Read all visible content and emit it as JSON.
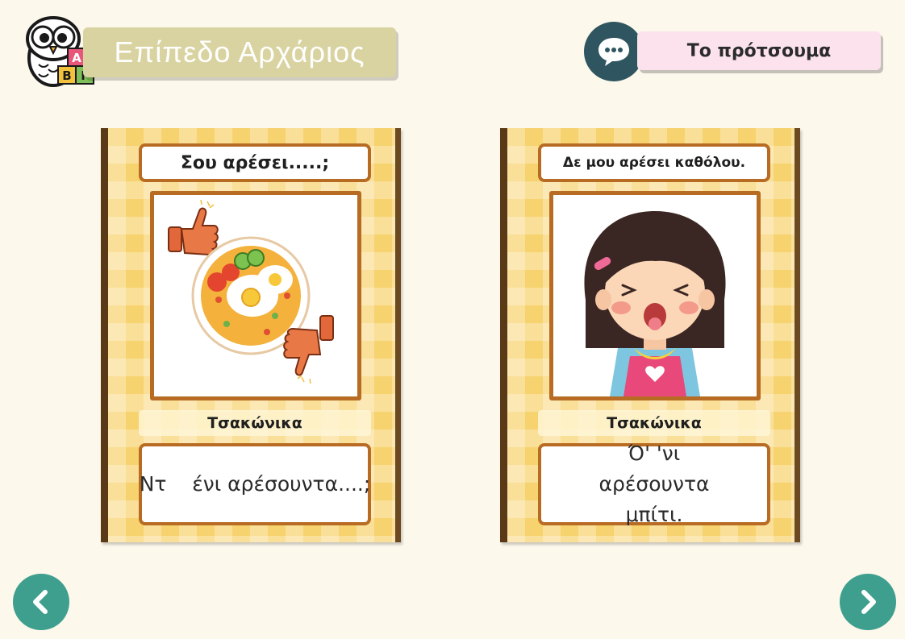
{
  "header": {
    "level_title": "Επίπεδο Αρχάριος",
    "pattern_button": "Το πρότσουμα",
    "logo_blocks": [
      "Α",
      "Β",
      "Γ"
    ]
  },
  "cards": [
    {
      "title": "Σου αρέσει.....;",
      "language": "Τσακώνικα",
      "phrase": "Ντ    ένι αρέσουντα....;",
      "image": "food-plate-thumbs-up-down"
    },
    {
      "title": "Δε μου αρέσει καθόλου.",
      "language": "Τσακώνικα",
      "phrase": "Ό' 'νι αρέσουντα μπίτι.",
      "image": "girl-disgusted-face"
    }
  ],
  "navigation": {
    "prev": "chevron-left-icon",
    "next": "chevron-right-icon"
  },
  "colors": {
    "background": "#fdf8ec",
    "card_yellow": "#f7d36f",
    "card_border": "#b86b22",
    "nav_teal": "#3f9f8e",
    "chat_circle": "#2f5660",
    "pattern_button_bg": "#fbe2ec",
    "level_banner_bg": "#d9d3a1"
  }
}
